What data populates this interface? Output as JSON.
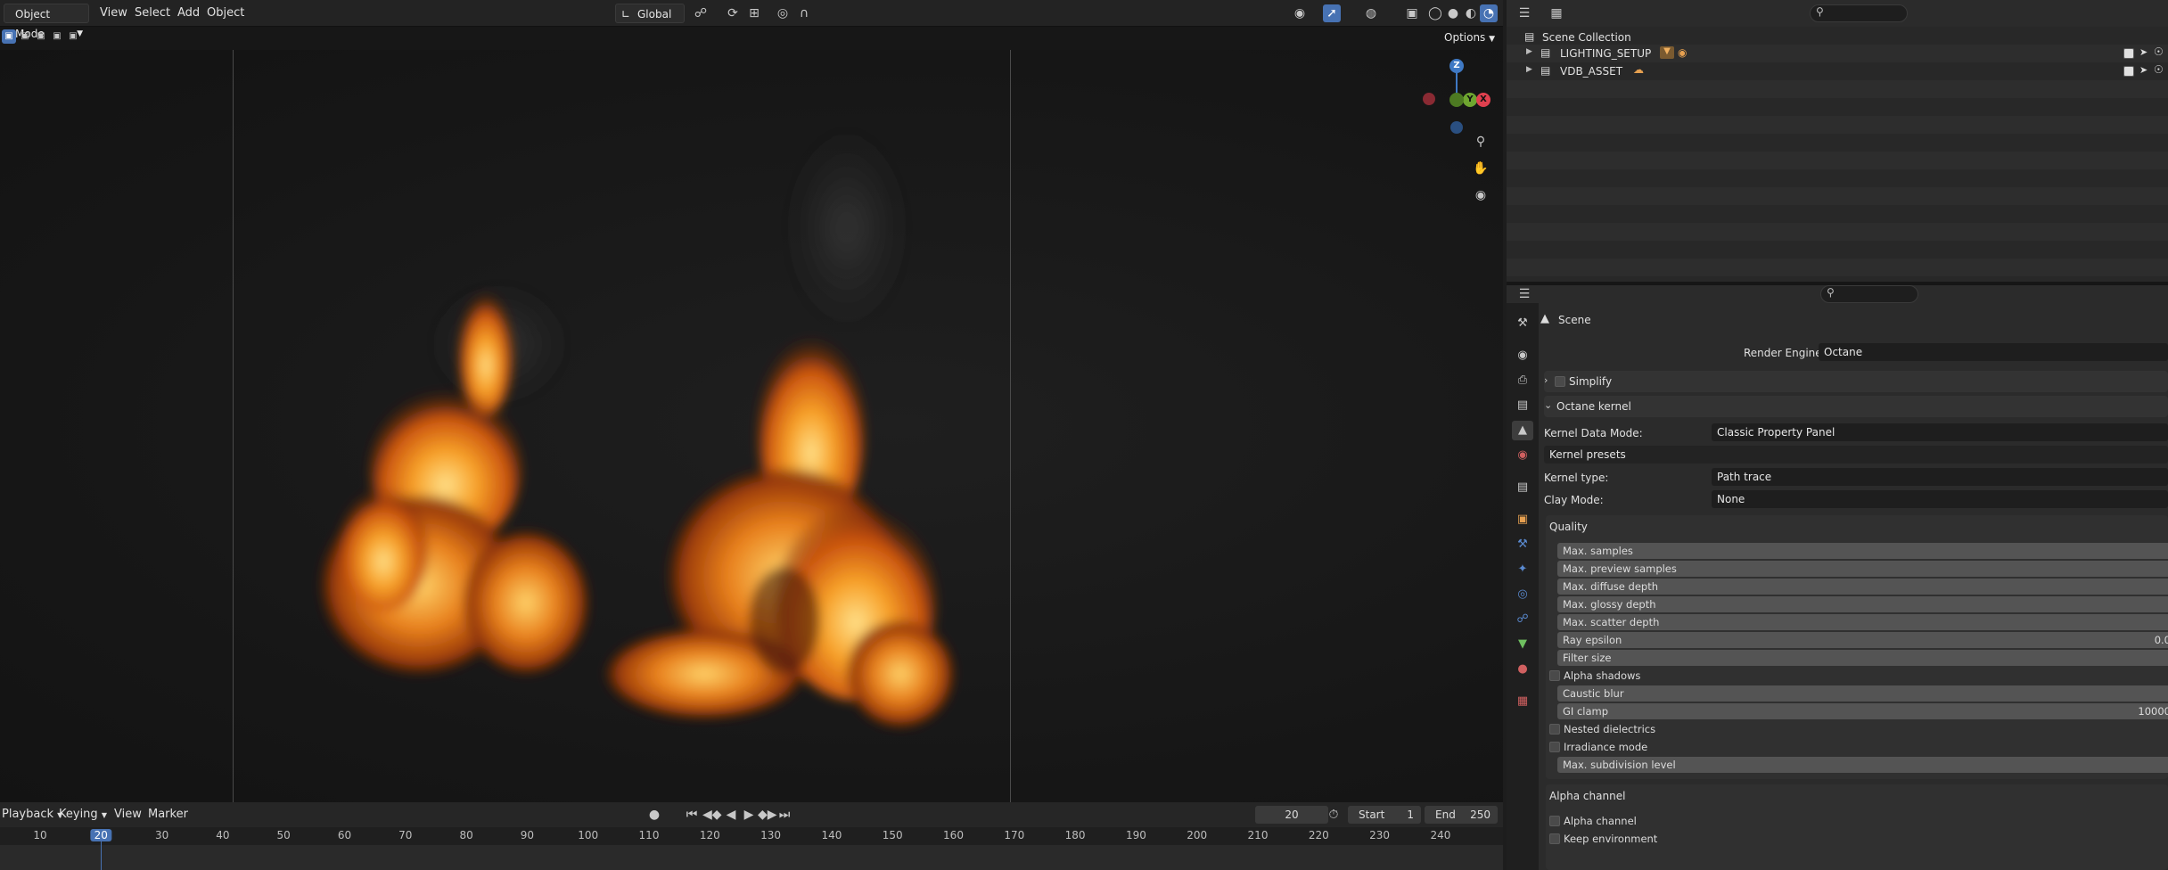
{
  "viewport": {
    "mode": "Object Mode",
    "menus": [
      "View",
      "Select",
      "Add",
      "Object"
    ],
    "transform_orientation": "Global",
    "options_label": "Options",
    "gizmo": {
      "z": "Z",
      "y": "Y",
      "x": "X"
    }
  },
  "timeline": {
    "menus": [
      "Playback",
      "Keying",
      "View",
      "Marker"
    ],
    "current_frame": "20",
    "start_label": "Start",
    "start_value": "1",
    "end_label": "End",
    "end_value": "250",
    "ruler": [
      "10",
      "20",
      "30",
      "40",
      "50",
      "60",
      "70",
      "80",
      "90",
      "100",
      "110",
      "120",
      "130",
      "140",
      "150",
      "160",
      "170",
      "180",
      "190",
      "200",
      "210",
      "220",
      "230",
      "240"
    ]
  },
  "outliner": {
    "root": "Scene Collection",
    "items": [
      {
        "label": "LIGHTING_SETUP"
      },
      {
        "label": "VDB_ASSET"
      }
    ]
  },
  "properties": {
    "context": "Scene",
    "render_engine_label": "Render Engine",
    "render_engine_value": "Octane",
    "simplify_label": "Simplify",
    "octane_kernel_label": "Octane kernel",
    "kernel_data_mode_label": "Kernel Data Mode:",
    "kernel_data_mode_value": "Classic Property Panel",
    "kernel_presets_label": "Kernel presets",
    "kernel_type_label": "Kernel type:",
    "kernel_type_value": "Path trace",
    "clay_mode_label": "Clay Mode:",
    "clay_mode_value": "None",
    "quality_label": "Quality",
    "quality_rows": [
      {
        "label": "Max. samples",
        "value": ""
      },
      {
        "label": "Max. preview samples",
        "value": ""
      },
      {
        "label": "Max. diffuse depth",
        "value": ""
      },
      {
        "label": "Max. glossy depth",
        "value": ""
      },
      {
        "label": "Max. scatter depth",
        "value": ""
      },
      {
        "label": "Ray epsilon",
        "value": "0.0"
      },
      {
        "label": "Filter size",
        "value": ""
      }
    ],
    "alpha_shadows_label": "Alpha shadows",
    "caustic_blur_label": "Caustic blur",
    "gi_clamp_label": "GI clamp",
    "gi_clamp_value": "10000",
    "nested_dielectrics_label": "Nested dielectrics",
    "irradiance_mode_label": "Irradiance mode",
    "max_subdivision_label": "Max. subdivision level",
    "alpha_channel_section": "Alpha channel",
    "alpha_channel_label": "Alpha channel",
    "keep_environment_label": "Keep environment"
  },
  "colors": {
    "accent": "#4772b3",
    "axis_x": "#e0404f",
    "axis_y": "#6fa630",
    "axis_z": "#3f79c4"
  }
}
